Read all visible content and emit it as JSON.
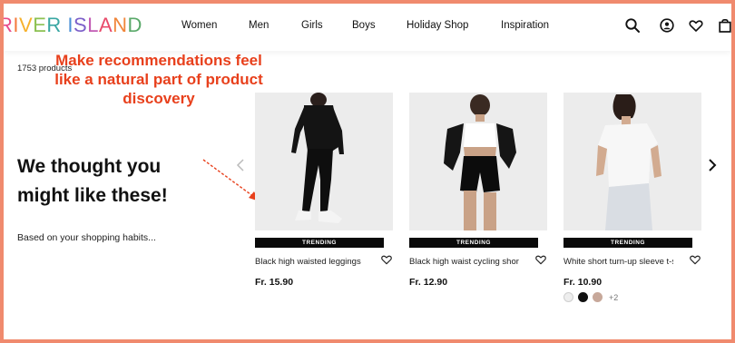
{
  "brand": {
    "letters": [
      "R",
      "I",
      "V",
      "E",
      "R",
      " ",
      "I",
      "S",
      "L",
      "A",
      "N",
      "D"
    ],
    "letter_colors": [
      "#e94b8b",
      "#f47a3d",
      "#f6b12c",
      "#8cc152",
      "#3aa7a3",
      "#ffffff",
      "#4a8fd6",
      "#7c5fc9",
      "#c15ab4",
      "#e94b6b",
      "#f0863a",
      "#5aa96a"
    ]
  },
  "nav": {
    "items": [
      "Women",
      "Men",
      "Girls",
      "Boys",
      "Holiday Shop",
      "Inspiration"
    ]
  },
  "header_icons": [
    "search-icon",
    "account-icon",
    "wishlist-heart-icon",
    "bag-icon"
  ],
  "results": {
    "count_text": "1753 products"
  },
  "annotation": {
    "text": "Make recommendations feel like a natural part of product discovery",
    "color": "#e8401c"
  },
  "recommendations": {
    "heading": "We thought you might like these!",
    "subtext": "Based on your shopping habits..."
  },
  "products": [
    {
      "badge": "TRENDING",
      "title": "Black high waisted leggings",
      "price": "Fr. 15.90"
    },
    {
      "badge": "TRENDING",
      "title": "Black high waist cycling shorts",
      "price": "Fr. 12.90"
    },
    {
      "badge": "TRENDING",
      "title": "White short turn-up sleeve t-shirt",
      "price": "Fr. 10.90"
    }
  ],
  "swatches": {
    "colors": [
      "#eeeeee",
      "#111111",
      "#c7a89a"
    ],
    "more_label": "+2"
  }
}
